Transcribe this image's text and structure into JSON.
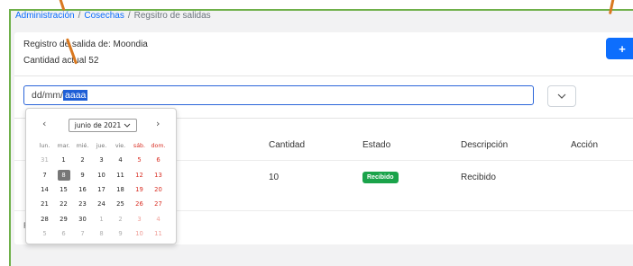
{
  "breadcrumb": {
    "items": [
      "Administración",
      "Cosechas"
    ],
    "separator": "/",
    "current": "Regsitro de salidas"
  },
  "info": {
    "registro": "Registro de salida de: Moondia",
    "cantidad": "Cantidad actual 52"
  },
  "add_button": {
    "label": "+"
  },
  "date_input": {
    "dd": "dd",
    "mm": "mm",
    "yyyy": "aaaa",
    "sep": "/"
  },
  "dropdown_button": {
    "icon": "chevron-down"
  },
  "table": {
    "headers": [
      "Cantidad",
      "Estado",
      "Descripción",
      "Acción"
    ],
    "row": {
      "cantidad": "10",
      "estado": "Recibido",
      "descripcion": "Recibido"
    }
  },
  "footer_partial": "R",
  "calendar": {
    "prev": "‹",
    "next": "›",
    "month_label": "junio de 2021",
    "weekdays": [
      "lun.",
      "mar.",
      "mié.",
      "jue.",
      "vie.",
      "sáb.",
      "dom."
    ],
    "weeks": [
      [
        "31",
        "1",
        "2",
        "3",
        "4",
        "5",
        "6"
      ],
      [
        "7",
        "8",
        "9",
        "10",
        "11",
        "12",
        "13"
      ],
      [
        "14",
        "15",
        "16",
        "17",
        "18",
        "19",
        "20"
      ],
      [
        "21",
        "22",
        "23",
        "24",
        "25",
        "26",
        "27"
      ],
      [
        "28",
        "29",
        "30",
        "1",
        "2",
        "3",
        "4"
      ],
      [
        "5",
        "6",
        "7",
        "8",
        "9",
        "10",
        "11"
      ]
    ],
    "today": "8"
  },
  "colors": {
    "primary": "#0d6efd",
    "badge_success": "#1aa34a",
    "weekend": "#d93025",
    "frame_border": "#6fb04a",
    "annotation_arrow": "#d9781f"
  }
}
